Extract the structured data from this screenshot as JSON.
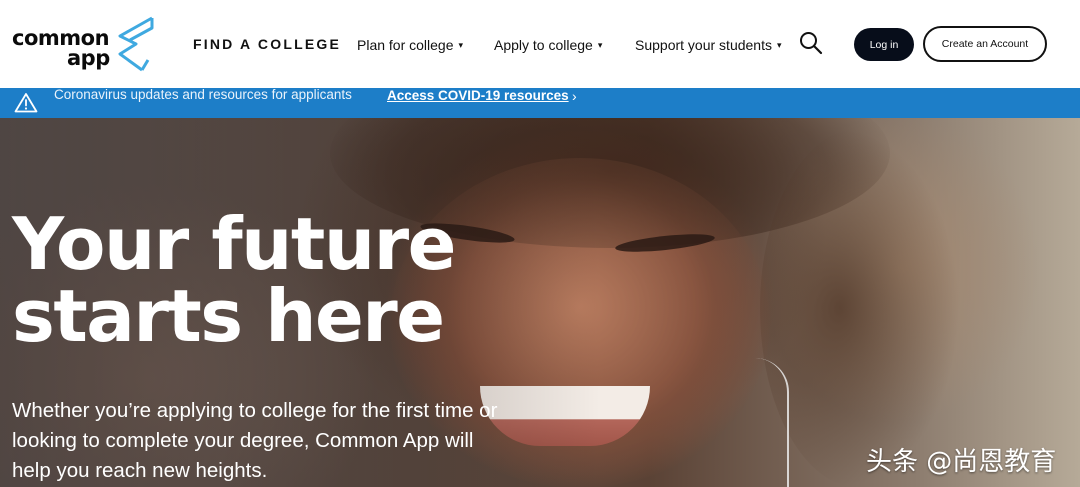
{
  "brand": {
    "logo_line1": "common",
    "logo_line2": "app",
    "logo_color": "#3fa9e0"
  },
  "nav": {
    "find_college": "FIND A COLLEGE",
    "plan": "Plan for college",
    "apply": "Apply to college",
    "support": "Support your students",
    "caret": "▾"
  },
  "header_buttons": {
    "login": "Log in",
    "create": "Create an Account"
  },
  "alert": {
    "text": "Coronavirus updates and resources for applicants",
    "link": "Access COVID-19 resources",
    "chevron": "›",
    "background": "#1d7ec8"
  },
  "hero": {
    "title_line1": "Your future",
    "title_line2": "starts here",
    "subtitle_line1": "Whether you’re applying to college for the first time or",
    "subtitle_line2": "looking to complete your degree, Common App will",
    "subtitle_line3": "help you reach new heights."
  },
  "watermark": "头条 @尚恩教育",
  "icons": {
    "search": "search-icon",
    "warning": "warning-icon"
  }
}
